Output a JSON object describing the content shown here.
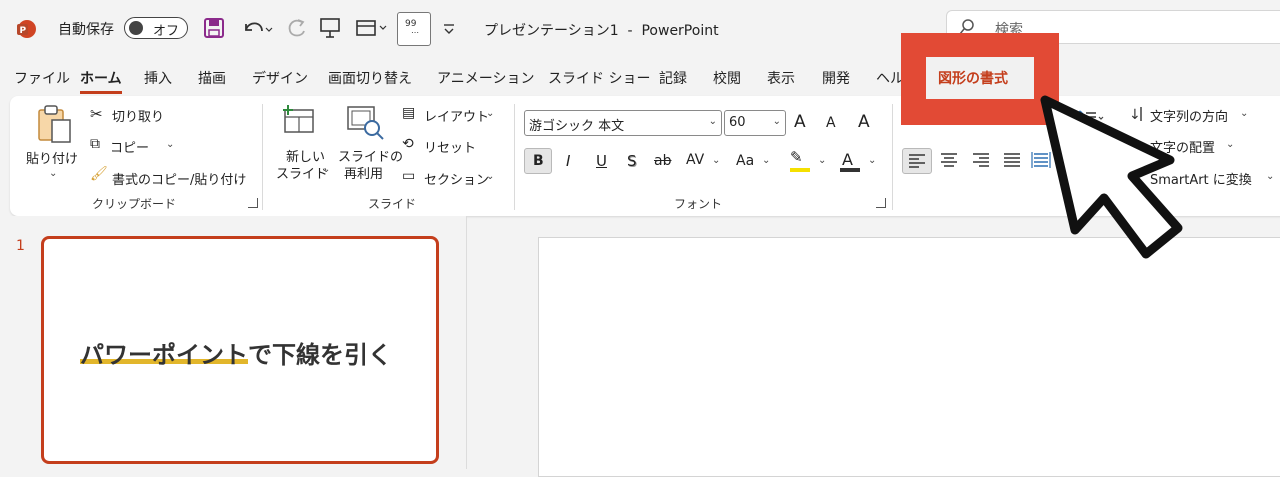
{
  "titlebar": {
    "autosave_label": "自動保存",
    "autosave_state": "オフ",
    "doc_title": "プレゼンテーション1  -  PowerPoint",
    "search_placeholder": "検索",
    "app_icon": "powerpoint-icon",
    "quick_icons": [
      "save-icon",
      "undo-icon",
      "redo-icon",
      "present-icon",
      "layout-icon",
      "text-icon",
      "customize-icon"
    ]
  },
  "tabs": [
    {
      "label": "ファイル"
    },
    {
      "label": "ホーム",
      "active": true
    },
    {
      "label": "挿入"
    },
    {
      "label": "描画"
    },
    {
      "label": "デザイン"
    },
    {
      "label": "画面切り替え"
    },
    {
      "label": "アニメーション"
    },
    {
      "label": "スライド ショー"
    },
    {
      "label": "記録"
    },
    {
      "label": "校閲"
    },
    {
      "label": "表示"
    },
    {
      "label": "開発"
    },
    {
      "label": "ヘル"
    }
  ],
  "highlight": {
    "label": "図形の書式",
    "color": "#e24a35"
  },
  "ribbon": {
    "clipboard": {
      "paste": "貼り付け",
      "cut": "切り取り",
      "copy": "コピー",
      "format_painter": "書式のコピー/貼り付け",
      "group_label": "クリップボード"
    },
    "slides": {
      "new_slide_1": "新しい",
      "new_slide_2": "スライド",
      "reuse_1": "スライドの",
      "reuse_2": "再利用",
      "layout": "レイアウト",
      "reset": "リセット",
      "section": "セクション",
      "group_label": "スライド"
    },
    "font": {
      "font_name": "游ゴシック 本文",
      "font_size": "60",
      "bold": "B",
      "italic": "I",
      "underline": "U",
      "shadow": "S",
      "strike": "ab",
      "spacing": "AV",
      "case": "Aa",
      "grow": "A",
      "shrink": "A",
      "font_color": "A",
      "group_label": "フォント"
    },
    "paragraph": {
      "text_direction": "文字列の方向",
      "align_text": "文字の配置",
      "smartart": "SmartArt に変換"
    }
  },
  "slides_pane": {
    "slide_number": "1",
    "thumb_text": "パワーポイントで下線を引く"
  },
  "colors": {
    "accent": "#c43e1c",
    "underline": "#e2b62b"
  }
}
